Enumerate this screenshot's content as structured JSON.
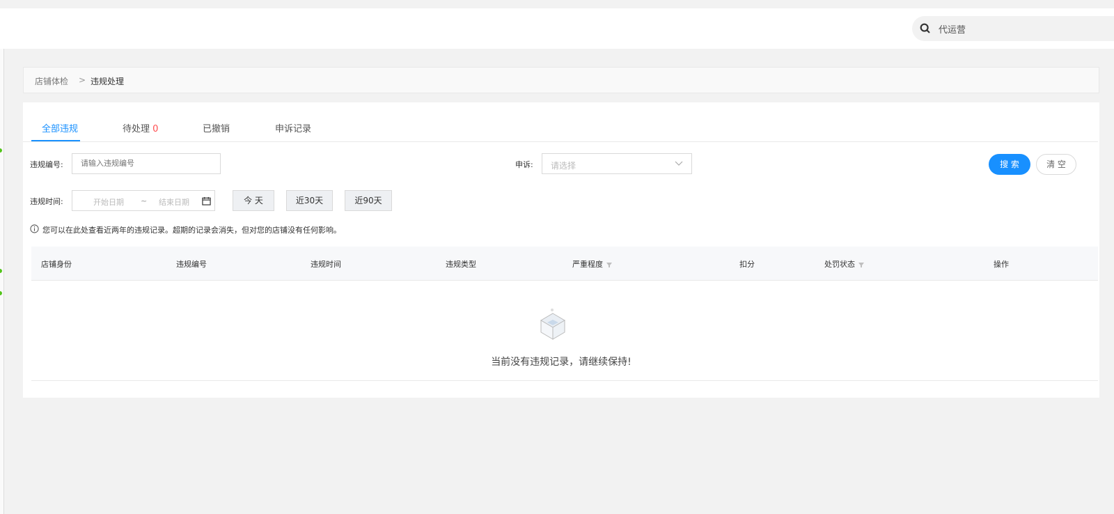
{
  "header": {
    "search_text": "代运营",
    "search_icon": "search-icon"
  },
  "breadcrumb": {
    "parent": "店铺体检",
    "separator": ">",
    "current": "违规处理"
  },
  "tabs": [
    {
      "label": "全部违规",
      "active": true
    },
    {
      "label": "待处理",
      "count": "0"
    },
    {
      "label": "已撤销"
    },
    {
      "label": "申诉记录"
    }
  ],
  "filters": {
    "violation_no_label": "违规编号:",
    "violation_no_placeholder": "请输入违规编号",
    "appeal_label": "申诉:",
    "appeal_placeholder": "请选择",
    "time_label": "违规时间:",
    "start_placeholder": "开始日期",
    "range_sep": "~",
    "end_placeholder": "结束日期",
    "today": "今 天",
    "last30": "近30天",
    "last90": "近90天",
    "search_btn": "搜 索",
    "clear_btn": "清 空"
  },
  "notice": "您可以在此处查看近两年的违规记录。超期的记录会消失，但对您的店铺没有任何影响。",
  "table": {
    "columns": [
      "店铺身份",
      "违规编号",
      "违规时间",
      "违规类型",
      "严重程度",
      "扣分",
      "处罚状态",
      "操作"
    ],
    "rows": []
  },
  "empty_text": "当前没有违规记录，请继续保持!",
  "colors": {
    "accent": "#1890ff",
    "count": "#ff4d4f",
    "status_dot": "#52c41a"
  }
}
